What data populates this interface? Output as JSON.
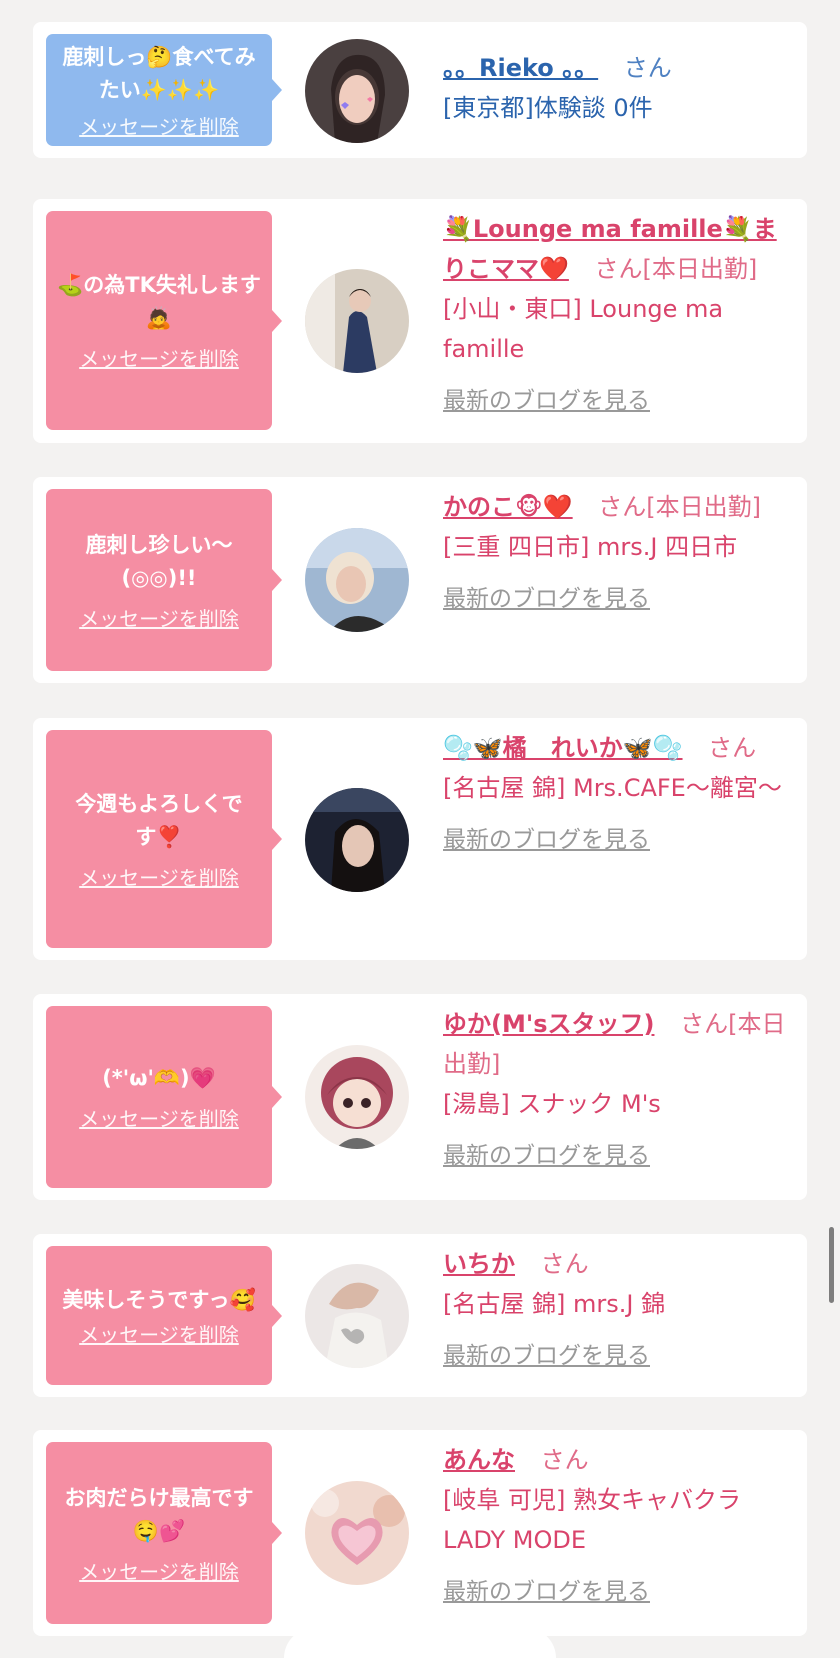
{
  "cards": [
    {
      "message": "鹿刺しっ🤔食べてみたい✨✨✨",
      "delete_label": "メッセージを削除",
      "name": "。。Rieko 。。",
      "suffix": "さん",
      "detail": "[東京都]体験談 0件",
      "blog_label": ""
    },
    {
      "message": "⛳の為TK失礼します🙇",
      "delete_label": "メッセージを削除",
      "name": "💐Lounge ma famille💐まりこママ❤️",
      "suffix": "さん[本日出勤]",
      "detail": "[小山・東口] Lounge ma famille",
      "blog_label": "最新のブログを見る"
    },
    {
      "message": "鹿刺し珍しい〜(◎◎)!!",
      "delete_label": "メッセージを削除",
      "name": "かのこ🐵❤️",
      "suffix": "さん[本日出勤]",
      "detail": "[三重 四日市] mrs.J 四日市",
      "blog_label": "最新のブログを見る"
    },
    {
      "message": "今週もよろしくです❣️",
      "delete_label": "メッセージを削除",
      "name": "🫧🦋橘　れいか🦋🫧",
      "suffix": "さん",
      "detail": "[名古屋 錦] Mrs.CAFE〜離宮〜",
      "blog_label": "最新のブログを見る"
    },
    {
      "message": "(*'ω'🫶)💗",
      "delete_label": "メッセージを削除",
      "name": "ゆか(M'sスタッフ)",
      "suffix": "さん[本日出勤]",
      "detail": "[湯島] スナック M's",
      "blog_label": "最新のブログを見る"
    },
    {
      "message": "美味しそうですっ🥰",
      "delete_label": "メッセージを削除",
      "name": "いちか",
      "suffix": "さん",
      "detail": "[名古屋 錦] mrs.J 錦",
      "blog_label": "最新のブログを見る"
    },
    {
      "message": "お肉だらけ最高です🤤💕",
      "delete_label": "メッセージを削除",
      "name": "あんな",
      "suffix": "さん",
      "detail": "[岐阜 可児] 熟女キャバクラ LADY MODE",
      "blog_label": "最新のブログを見る"
    }
  ],
  "colors": {
    "bubble_blue": "#8fb9ee",
    "bubble_pink": "#f58ea3",
    "link_blue": "#2b64ad",
    "link_pink": "#d9436b",
    "blog_gray": "#999999"
  }
}
